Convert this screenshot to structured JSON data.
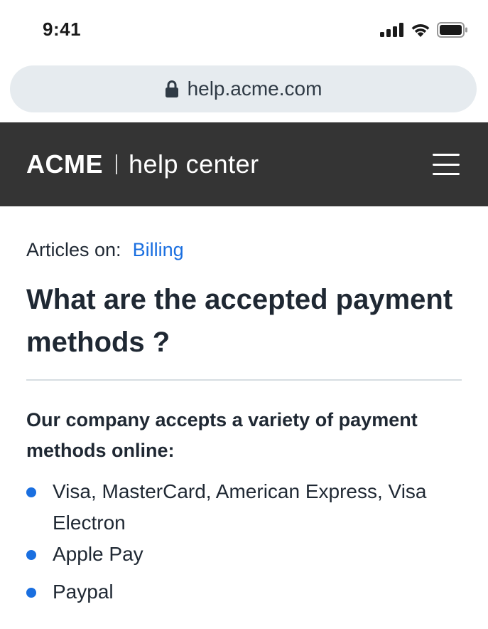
{
  "status_bar": {
    "time": "9:41",
    "icons": [
      "cellular-signal-icon",
      "wifi-icon",
      "battery-icon"
    ]
  },
  "browser": {
    "url": "help.acme.com",
    "lock_icon": "lock-icon"
  },
  "header": {
    "brand": "ACME",
    "subtitle": "help center",
    "menu_icon": "hamburger-menu-icon",
    "background": "#343434"
  },
  "article": {
    "crumb_label": "Articles on:",
    "category": "Billing",
    "title": "What are the accepted payment methods ?",
    "intro": "Our company accepts a variety of payment methods online:",
    "methods": [
      "Visa, MasterCard, American Express, Visa Electron",
      "Apple Pay",
      "Paypal"
    ]
  },
  "colors": {
    "accent": "#1a6fe0",
    "text": "#1f2833"
  }
}
